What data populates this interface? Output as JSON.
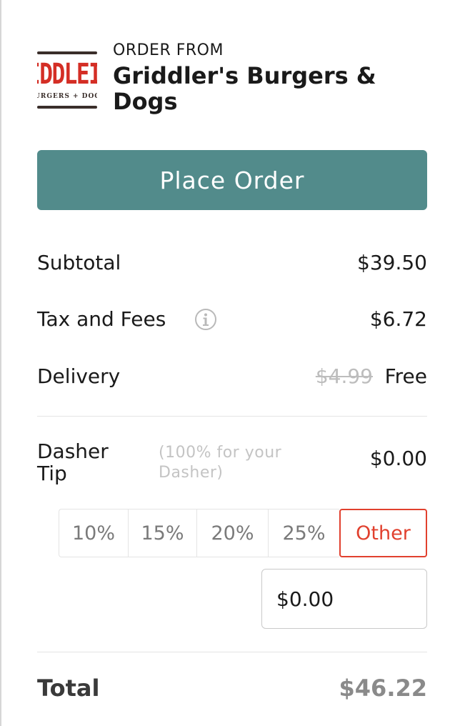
{
  "header": {
    "order_from": "ORDER FROM",
    "store_name": "Griddler's Burgers & Dogs",
    "logo_text": "IDDLEI",
    "logo_tagline": "URGERS + DOG"
  },
  "actions": {
    "place_order": "Place Order"
  },
  "summary": {
    "subtotal_label": "Subtotal",
    "subtotal_value": "$39.50",
    "tax_label": "Tax and Fees",
    "tax_value": "$6.72",
    "delivery_label": "Delivery",
    "delivery_original": "$4.99",
    "delivery_value": "Free"
  },
  "tip": {
    "label": "Dasher Tip",
    "note": "(100% for your Dasher)",
    "value": "$0.00",
    "options": [
      "10%",
      "15%",
      "20%",
      "25%",
      "Other"
    ],
    "selected": "Other",
    "input_value": "$0.00"
  },
  "total": {
    "label": "Total",
    "value": "$46.22"
  },
  "colors": {
    "primary_button": "#528b8b",
    "selected_accent": "#e1402e",
    "logo_red": "#d42e25"
  }
}
